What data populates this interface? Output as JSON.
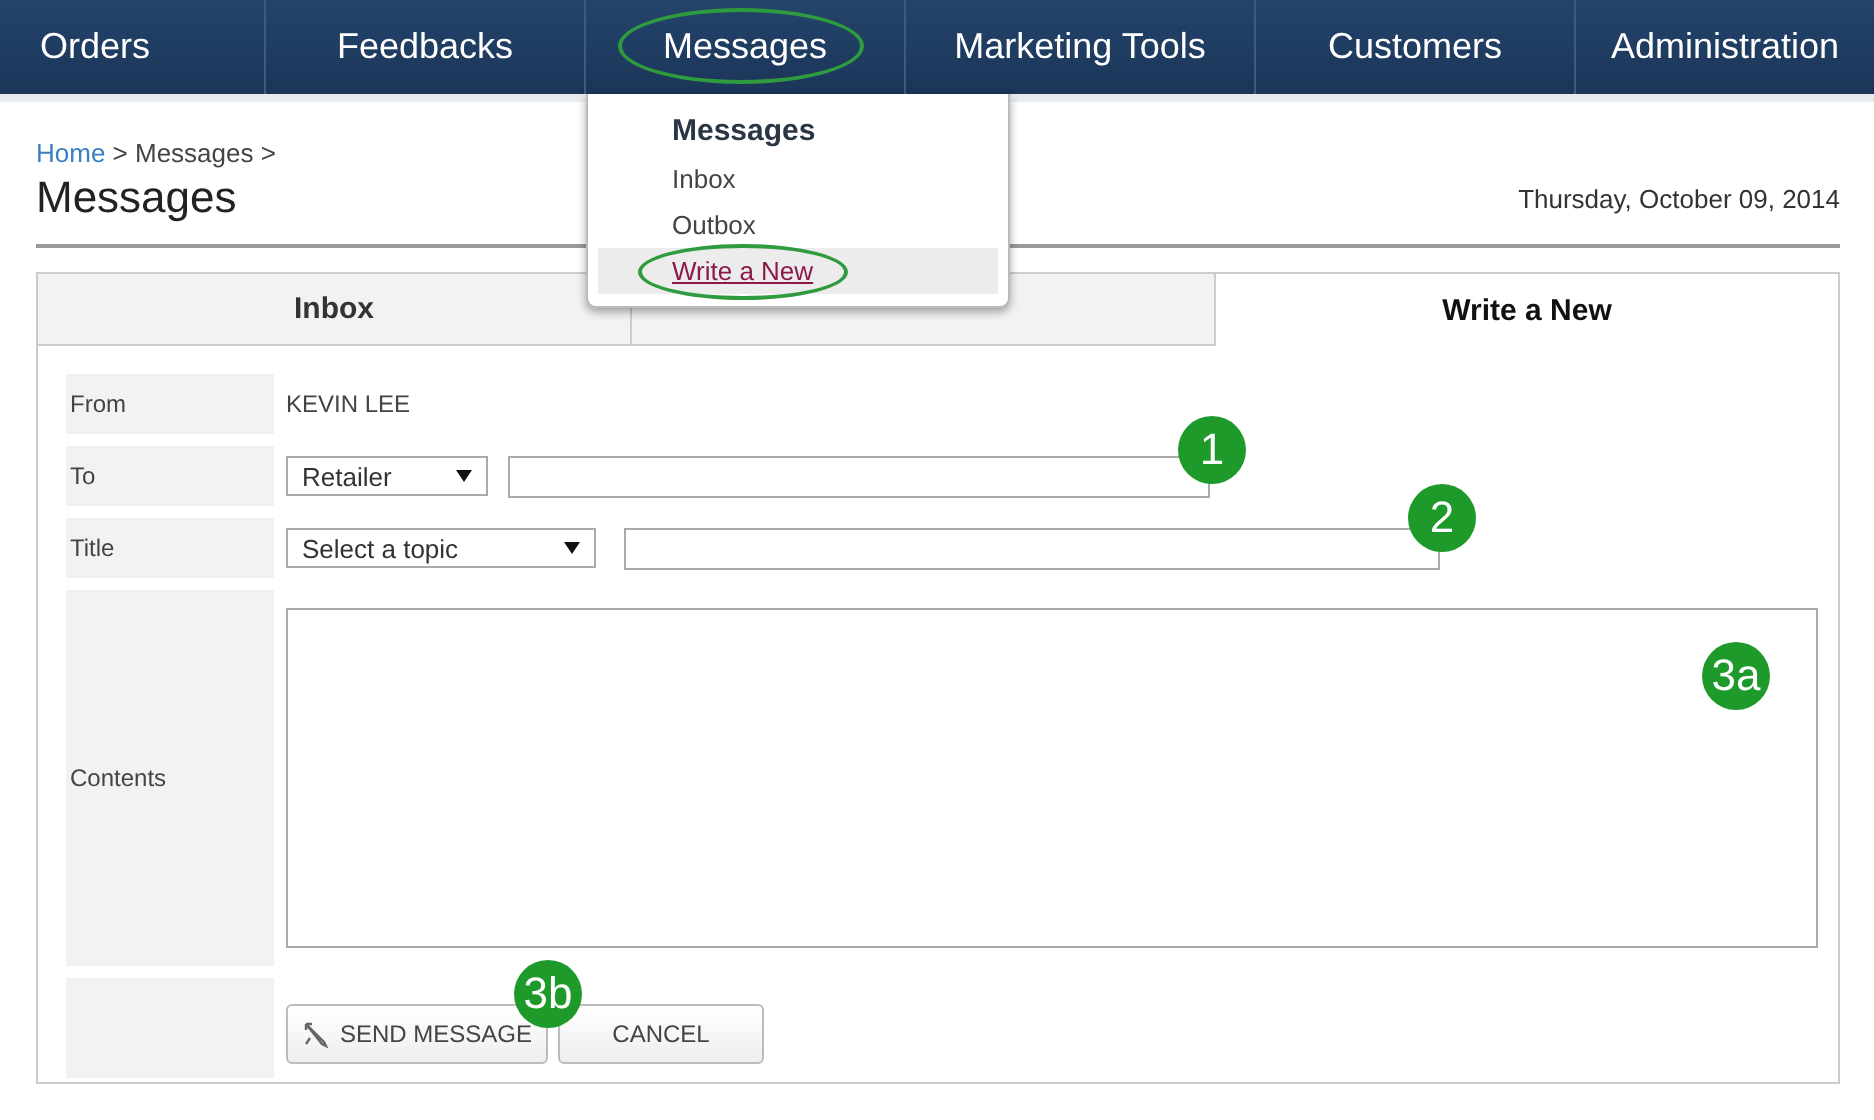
{
  "nav": [
    {
      "label": "Orders",
      "circled": false
    },
    {
      "label": "Feedbacks",
      "circled": false
    },
    {
      "label": "Messages",
      "circled": true
    },
    {
      "label": "Marketing Tools",
      "circled": false
    },
    {
      "label": "Customers",
      "circled": false
    },
    {
      "label": "Administration",
      "circled": false
    }
  ],
  "dropdown": {
    "heading": "Messages",
    "items": [
      {
        "label": "Inbox",
        "highlighted": false,
        "circled": false
      },
      {
        "label": "Outbox",
        "highlighted": false,
        "circled": false
      },
      {
        "label": "Write a New",
        "highlighted": true,
        "circled": true
      }
    ]
  },
  "breadcrumb": {
    "link": "Home",
    "rest": "> Messages >"
  },
  "page_title": "Messages",
  "date": "Thursday, October 09, 2014",
  "tabs": [
    {
      "label": "Inbox",
      "selected": false
    },
    {
      "selected": false
    },
    {
      "label": "Write a New",
      "selected": true
    }
  ],
  "form": {
    "from_label": "From",
    "from_value": "KEVIN LEE",
    "to_label": "To",
    "to_select": "Retailer",
    "to_badge": "1",
    "title_label": "Title",
    "title_select": "Select a topic",
    "title_badge": "2",
    "contents_label": "Contents",
    "contents_badge": "3a",
    "send_button": "SEND MESSAGE",
    "send_badge": "3b",
    "cancel_button": "CANCEL"
  }
}
